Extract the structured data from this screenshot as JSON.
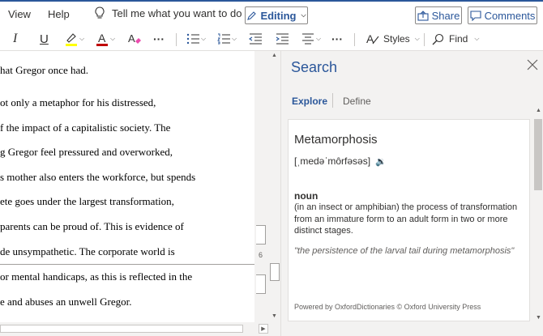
{
  "menu": {
    "view": "View",
    "help": "Help",
    "tell_me": "Tell me what you want to do",
    "editing": "Editing",
    "share": "Share",
    "comments": "Comments"
  },
  "ribbon": {
    "styles": "Styles",
    "find": "Find"
  },
  "document": {
    "lines": [
      "hat Gregor once had.",
      "ot only a metaphor for his distressed,",
      "f the impact of a capitalistic society. The",
      "g Gregor feel pressured and overworked,",
      "s mother also enters the workforce, but spends",
      "ete goes under the largest transformation,",
      "parents can be proud of. This is evidence of",
      "de unsympathetic. The corporate world is",
      "or mental handicaps, as this is reflected in the",
      "e and abuses an unwell Gregor."
    ],
    "page_number": "6"
  },
  "search_pane": {
    "title": "Search",
    "tabs": [
      "Explore",
      "Define"
    ],
    "word": "Metamorphosis",
    "pronunciation": "[ˌmedəˈmôrfəsəs]",
    "part_of_speech": "noun",
    "definition": "(in an insect or amphibian) the process of transformation from an immature form to an adult form in two or more distinct stages.",
    "example": "\"the persistence of the larval tail during metamorphosis\"",
    "credit": "Powered by OxfordDictionaries © Oxford University Press"
  },
  "colors": {
    "accent": "#2b579a",
    "highlight": "#ffff00",
    "font_color": "#c00000"
  }
}
